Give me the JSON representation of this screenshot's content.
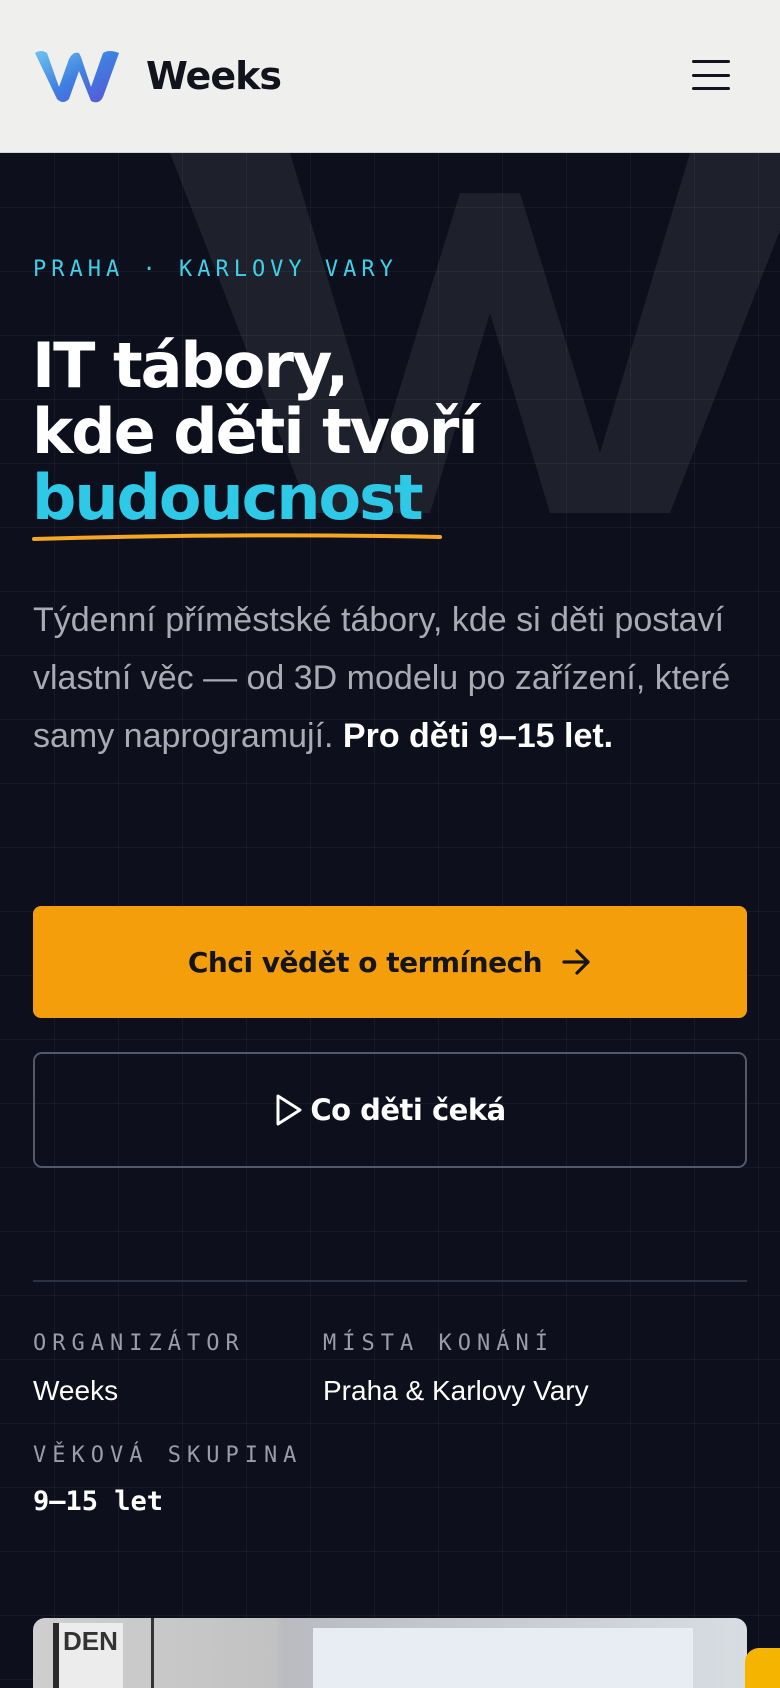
{
  "header": {
    "brand": "Weeks",
    "menu_icon": "hamburger-menu-icon"
  },
  "hero": {
    "eyebrow": "PRAHA · KARLOVY VARY",
    "title_line1": "IT tábory,",
    "title_line2": "kde děti tvoří",
    "title_accent": "budoucnost",
    "lead_text": "Týdenní příměstské tábory, kde si děti postaví vlastní věc — od 3D modelu po zařízení, které samy naprogramují. ",
    "lead_bold": "Pro děti 9–15 let.",
    "cta_primary": "Chci vědět o termínech",
    "cta_primary_icon": "arrow-right-icon",
    "cta_secondary": "Co děti čeká",
    "cta_secondary_icon": "play-icon"
  },
  "meta": {
    "organizer_label": "ORGANIZÁTOR",
    "organizer_value": "Weeks",
    "venues_label": "MÍSTA KONÁNÍ",
    "venues_value": "Praha & Karlovy Vary",
    "age_label": "VĚKOVÁ SKUPINA",
    "age_value": "9–15 let"
  },
  "photo": {
    "sign_text": "DEN"
  },
  "colors": {
    "background": "#0d0f1c",
    "accent_cyan": "#2ec9e6",
    "accent_orange": "#f59e0b",
    "header_bg": "#efefed"
  }
}
